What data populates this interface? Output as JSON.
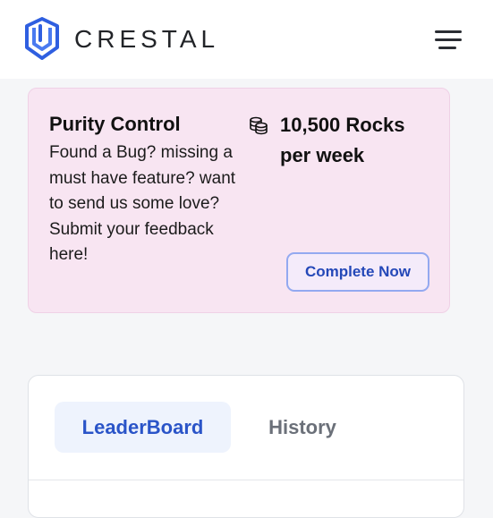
{
  "header": {
    "brand": "CRESTAL",
    "logo_icon": "crestal-logo-icon",
    "menu_icon": "hamburger-menu-icon"
  },
  "task_card": {
    "title": "Purity Control",
    "description": "Found a Bug? missing a must have feature? want to send us some love? Submit your feedback here!",
    "reward_icon": "coins-stack-icon",
    "reward": "10,500 Rocks per week",
    "cta_label": "Complete Now"
  },
  "panel": {
    "tabs": [
      {
        "label": "LeaderBoard",
        "active": true
      },
      {
        "label": "History",
        "active": false
      }
    ]
  },
  "colors": {
    "accent": "#2a54c8",
    "card_background": "#f8e5f2",
    "button_border": "#93a9f0",
    "logo_blue": "#2f5fe0"
  }
}
